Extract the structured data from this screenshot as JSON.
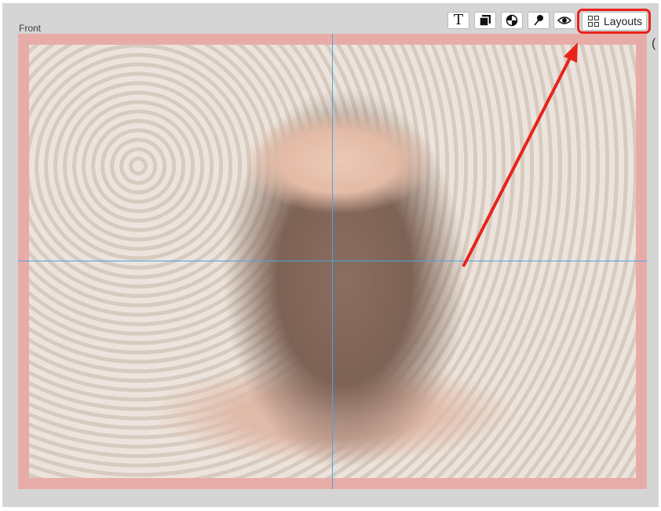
{
  "panel": {
    "label": "Front"
  },
  "toolbar": {
    "buttons": [
      {
        "name": "text",
        "glyph": "T",
        "icon": "text-icon"
      },
      {
        "name": "shape",
        "icon": "shape-icon"
      },
      {
        "name": "color",
        "icon": "color-wheel-icon"
      },
      {
        "name": "pin",
        "icon": "pin-icon"
      },
      {
        "name": "preview",
        "icon": "eye-icon"
      }
    ],
    "layouts_label": "Layouts",
    "layouts_icon": "grid-icon"
  },
  "canvas": {
    "image": "newborn-photo",
    "bleed_color": "#ec7d78",
    "guide_color": "#4aa3e6"
  },
  "annotation": {
    "color": "#e8231c"
  }
}
